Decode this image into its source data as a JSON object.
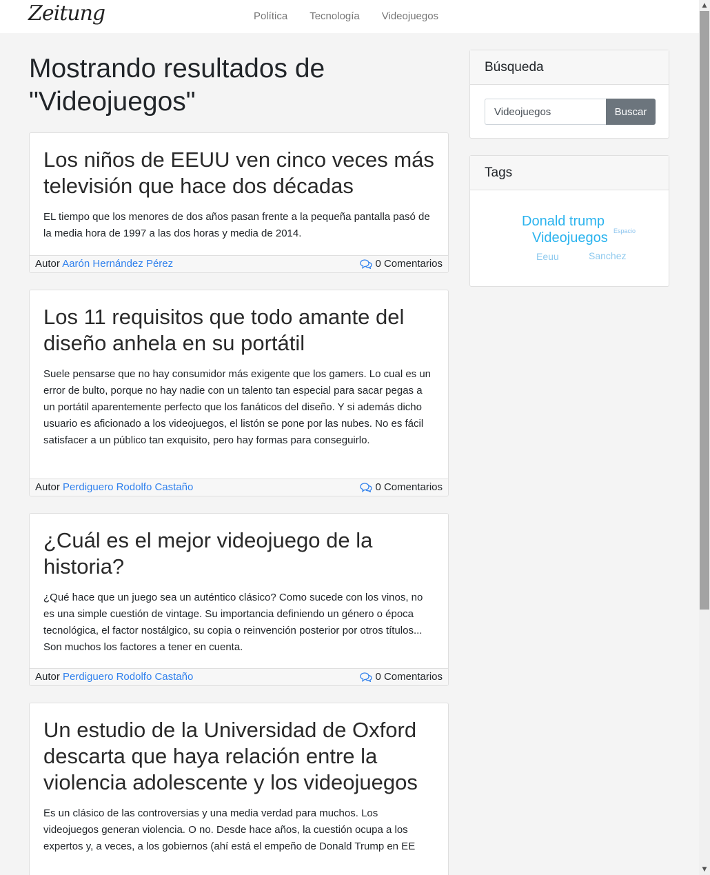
{
  "navbar": {
    "brand": "Zeitung",
    "links": [
      "Política",
      "Tecnología",
      "Videojuegos"
    ]
  },
  "heading": "Mostrando resultados de \"Videojuegos\"",
  "posts": [
    {
      "title": "Los niños de EEUU ven cinco veces más televisión que hace dos décadas",
      "excerpt": "EL tiempo que los menores de dos años pasan frente a la pequeña pantalla pasó de la media hora de 1997 a las dos horas y media de 2014.",
      "author_prefix": "Autor",
      "author": "Aarón Hernández Pérez",
      "comments": "0 Comentarios"
    },
    {
      "title": "Los 11 requisitos que todo amante del diseño anhela en su portátil",
      "excerpt": "Suele pensarse que no hay consumidor más exigente que los gamers. Lo cual es un error de bulto, porque no hay nadie con un talento tan especial para sacar pegas a un portátil aparentemente perfecto que los fanáticos del diseño. Y si además dicho usuario es aficionado a los videojuegos, el listón se pone por las nubes. No es fácil satisfacer a un público tan exquisito, pero hay formas para conseguirlo.",
      "author_prefix": "Autor",
      "author": "Perdiguero Rodolfo Castaño",
      "comments": "0 Comentarios"
    },
    {
      "title": "¿Cuál es el mejor videojuego de la historia?",
      "excerpt": "¿Qué hace que un juego sea un auténtico clásico? Como sucede con los vinos, no es una simple cuestión de vintage. Su importancia definiendo un género o época tecnológica, el factor nostálgico, su copia o reinvención posterior por otros títulos... Son muchos los factores a tener en cuenta.",
      "author_prefix": "Autor",
      "author": "Perdiguero Rodolfo Castaño",
      "comments": "0 Comentarios"
    },
    {
      "title": "Un estudio de la Universidad de Oxford descarta que haya relación entre la violencia adolescente y los videojuegos",
      "excerpt": "Es un clásico de las controversias y una media verdad para muchos. Los videojuegos generan violencia. O no. Desde hace años, la cuestión ocupa a los expertos y, a veces, a los gobiernos (ahí está el empeño de Donald Trump en EE"
    }
  ],
  "sidebar": {
    "search": {
      "title": "Búsqueda",
      "value": "Videojuegos",
      "button": "Buscar"
    },
    "tags": {
      "title": "Tags",
      "items": [
        {
          "label": "Donald trump",
          "color": "#2ab3ee"
        },
        {
          "label": "Espacio",
          "color": "#8cc4ee"
        },
        {
          "label": "Videojuegos",
          "color": "#2ab3ee"
        },
        {
          "label": "Eeuu",
          "color": "#8ec9ee"
        },
        {
          "label": "Sanchez",
          "color": "#8ec9ee"
        }
      ]
    }
  },
  "colors": {
    "link": "#2f80ed",
    "button": "#6c757d",
    "background": "#f4f4f4"
  }
}
